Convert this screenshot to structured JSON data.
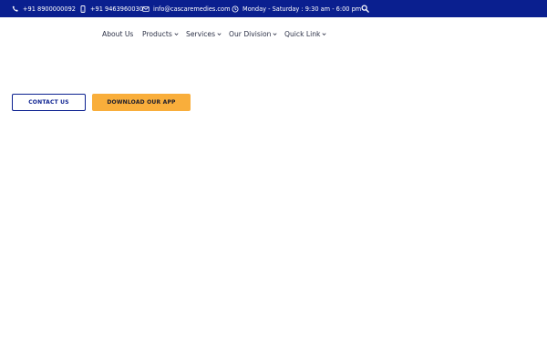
{
  "colors": {
    "topbar_bg": "#0a1f8f",
    "accent": "#f9ae3b",
    "primary": "#0a1f8f"
  },
  "topbar": {
    "phone1": "+91 8900000092",
    "phone1_icon": "phone-icon",
    "phone2": "+91 9463960030",
    "phone2_icon": "mobile-icon",
    "email": "info@cascaremedies.com",
    "email_icon": "envelope-icon",
    "hours": "Monday - Saturday : 9:30 am - 6:00 pm",
    "hours_icon": "clock-icon",
    "search_icon": "search-icon"
  },
  "nav": {
    "items": [
      {
        "label": "About Us",
        "has_dropdown": false
      },
      {
        "label": "Products",
        "has_dropdown": true
      },
      {
        "label": "Services",
        "has_dropdown": true
      },
      {
        "label": "Our Division",
        "has_dropdown": true
      },
      {
        "label": "Quick Link",
        "has_dropdown": true
      }
    ]
  },
  "actions": {
    "contact_label": "CONTACT US",
    "download_label": "DOWNLOAD OUR APP"
  }
}
